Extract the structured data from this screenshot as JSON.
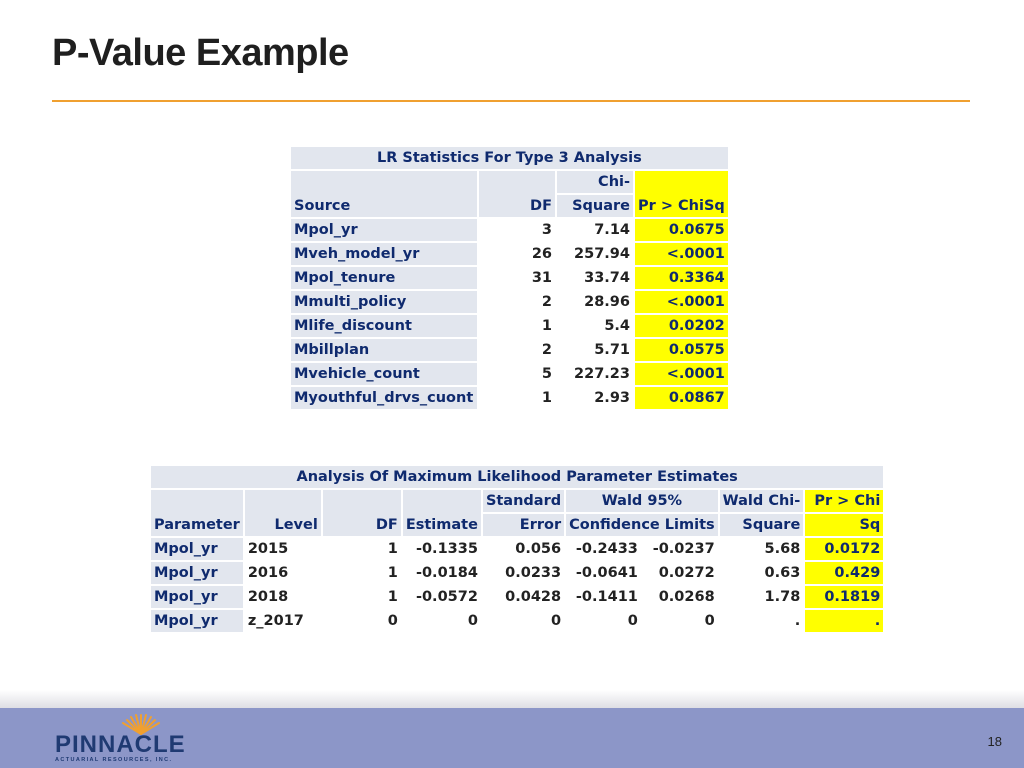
{
  "slide": {
    "title": "P-Value Example",
    "page_number": "18"
  },
  "table1": {
    "caption": "LR Statistics For Type 3 Analysis",
    "headers": {
      "source": "Source",
      "df": "DF",
      "chisq_top": "Chi-",
      "chisq_bottom": "Square",
      "p": "Pr > ChiSq"
    },
    "rows": [
      {
        "source": "Mpol_yr",
        "df": "3",
        "chisq": "7.14",
        "p": "0.0675"
      },
      {
        "source": "Mveh_model_yr",
        "df": "26",
        "chisq": "257.94",
        "p": "<.0001"
      },
      {
        "source": "Mpol_tenure",
        "df": "31",
        "chisq": "33.74",
        "p": "0.3364"
      },
      {
        "source": "Mmulti_policy",
        "df": "2",
        "chisq": "28.96",
        "p": "<.0001"
      },
      {
        "source": "Mlife_discount",
        "df": "1",
        "chisq": "5.4",
        "p": "0.0202"
      },
      {
        "source": "Mbillplan",
        "df": "2",
        "chisq": "5.71",
        "p": "0.0575"
      },
      {
        "source": "Mvehicle_count",
        "df": "5",
        "chisq": "227.23",
        "p": "<.0001"
      },
      {
        "source": "Myouthful_drvs_cuont",
        "df": "1",
        "chisq": "2.93",
        "p": "0.0867"
      }
    ]
  },
  "table2": {
    "caption": "Analysis Of Maximum Likelihood Parameter Estimates",
    "headers": {
      "parameter": "Parameter",
      "level": "Level",
      "df": "DF",
      "estimate": "Estimate",
      "se_top": "Standard",
      "se_bottom": "Error",
      "wald_top": "Wald 95%",
      "wald_bottom": "Confidence Limits",
      "waldchi_top": "Wald Chi-",
      "waldchi_bottom": "Square",
      "p_top": "Pr > Chi",
      "p_bottom": "Sq"
    },
    "rows": [
      {
        "parameter": "Mpol_yr",
        "level": "2015",
        "df": "1",
        "estimate": "-0.1335",
        "se": "0.056",
        "lower": "-0.2433",
        "upper": "-0.0237",
        "waldchi": "5.68",
        "p": "0.0172"
      },
      {
        "parameter": "Mpol_yr",
        "level": "2016",
        "df": "1",
        "estimate": "-0.0184",
        "se": "0.0233",
        "lower": "-0.0641",
        "upper": "0.0272",
        "waldchi": "0.63",
        "p": "0.429"
      },
      {
        "parameter": "Mpol_yr",
        "level": "2018",
        "df": "1",
        "estimate": "-0.0572",
        "se": "0.0428",
        "lower": "-0.1411",
        "upper": "0.0268",
        "waldchi": "1.78",
        "p": "0.1819"
      },
      {
        "parameter": "Mpol_yr",
        "level": "z_2017",
        "df": "0",
        "estimate": "0",
        "se": "0",
        "lower": "0",
        "upper": "0",
        "waldchi": ".",
        "p": "."
      }
    ]
  },
  "footer": {
    "logo_name": "PINNACLE",
    "logo_subtitle": "ACTUARIAL RESOURCES, INC.",
    "logo_icon": "sunburst-icon",
    "brand_color": "#1f3a72",
    "accent_color": "#f0a030",
    "highlight_color": "#ffff00"
  }
}
